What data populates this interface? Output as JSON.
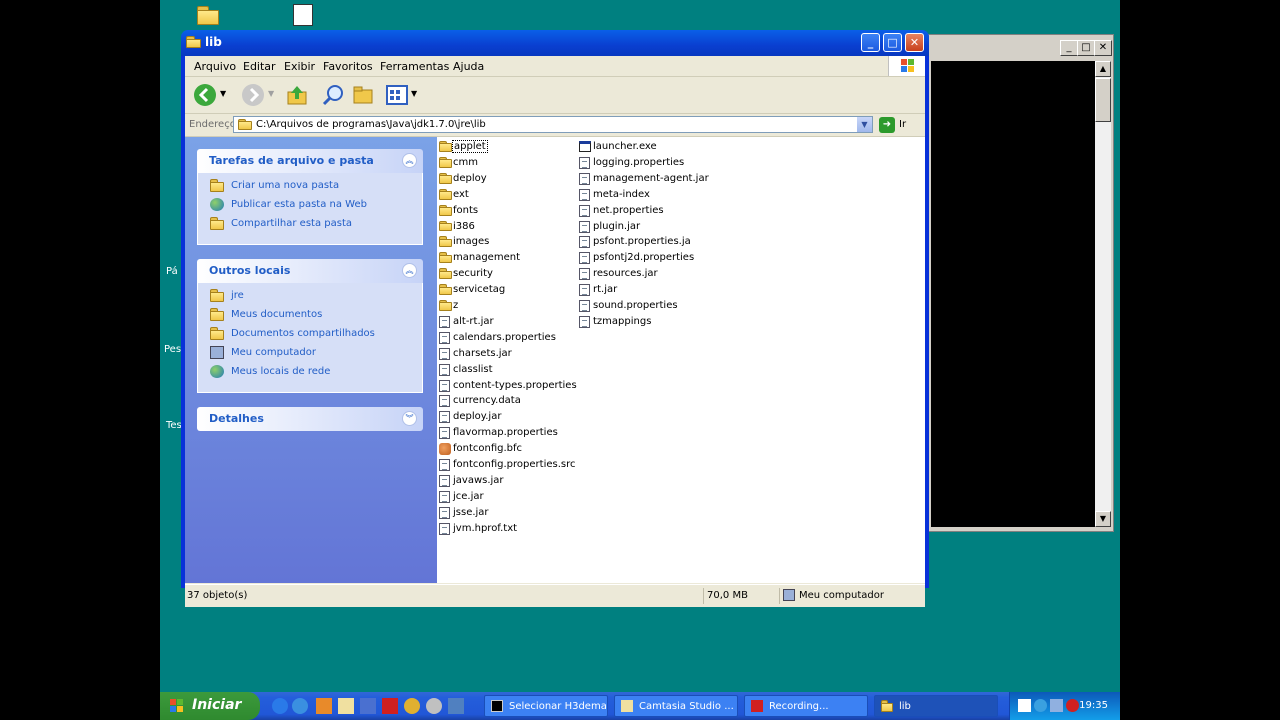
{
  "window": {
    "title": "lib",
    "menus": [
      "Arquivo",
      "Editar",
      "Exibir",
      "Favoritos",
      "Ferramentas",
      "Ajuda"
    ],
    "address_label": "Endereço",
    "address": "C:\\Arquivos de programas\\Java\\jdk1.7.0\\jre\\lib",
    "go_label": "Ir"
  },
  "tasks_panel": {
    "title": "Tarefas de arquivo e pasta",
    "items": [
      "Criar uma nova pasta",
      "Publicar esta pasta na Web",
      "Compartilhar esta pasta"
    ]
  },
  "places_panel": {
    "title": "Outros locais",
    "items": [
      "jre",
      "Meus documentos",
      "Documentos compartilhados",
      "Meu computador",
      "Meus locais de rede"
    ]
  },
  "details_panel": {
    "title": "Detalhes"
  },
  "files": {
    "col1": [
      {
        "name": "applet",
        "type": "folder"
      },
      {
        "name": "cmm",
        "type": "folder"
      },
      {
        "name": "deploy",
        "type": "folder"
      },
      {
        "name": "ext",
        "type": "folder"
      },
      {
        "name": "fonts",
        "type": "folder"
      },
      {
        "name": "i386",
        "type": "folder"
      },
      {
        "name": "images",
        "type": "folder"
      },
      {
        "name": "management",
        "type": "folder"
      },
      {
        "name": "security",
        "type": "folder"
      },
      {
        "name": "servicetag",
        "type": "folder"
      },
      {
        "name": "z",
        "type": "folder"
      },
      {
        "name": "alt-rt.jar",
        "type": "doc"
      },
      {
        "name": "calendars.properties",
        "type": "doc"
      },
      {
        "name": "charsets.jar",
        "type": "doc"
      },
      {
        "name": "classlist",
        "type": "doc"
      },
      {
        "name": "content-types.properties",
        "type": "doc"
      },
      {
        "name": "currency.data",
        "type": "doc"
      },
      {
        "name": "deploy.jar",
        "type": "doc"
      },
      {
        "name": "flavormap.properties",
        "type": "doc"
      },
      {
        "name": "fontconfig.bfc",
        "type": "java"
      },
      {
        "name": "fontconfig.properties.src",
        "type": "doc"
      },
      {
        "name": "javaws.jar",
        "type": "doc"
      },
      {
        "name": "jce.jar",
        "type": "doc"
      },
      {
        "name": "jsse.jar",
        "type": "doc"
      },
      {
        "name": "jvm.hprof.txt",
        "type": "doc"
      }
    ],
    "col2": [
      {
        "name": "launcher.exe",
        "type": "exe"
      },
      {
        "name": "logging.properties",
        "type": "doc"
      },
      {
        "name": "management-agent.jar",
        "type": "doc"
      },
      {
        "name": "meta-index",
        "type": "doc"
      },
      {
        "name": "net.properties",
        "type": "doc"
      },
      {
        "name": "plugin.jar",
        "type": "doc"
      },
      {
        "name": "psfont.properties.ja",
        "type": "doc"
      },
      {
        "name": "psfontj2d.properties",
        "type": "doc"
      },
      {
        "name": "resources.jar",
        "type": "doc"
      },
      {
        "name": "rt.jar",
        "type": "doc"
      },
      {
        "name": "sound.properties",
        "type": "doc"
      },
      {
        "name": "tzmappings",
        "type": "doc"
      }
    ]
  },
  "status": {
    "count": "37 objeto(s)",
    "size": "70,0 MB",
    "location": "Meu computador"
  },
  "desktop_labels": [
    "Pá",
    "Pes",
    "Tes"
  ],
  "taskbar": {
    "start": "Iniciar",
    "items": [
      "Selecionar H3dema",
      "Camtasia Studio ...",
      "Recording...",
      "lib"
    ],
    "clock": "19:35"
  },
  "colors": {
    "desktop": "#008080",
    "titlebar": "#0a5fe8",
    "sidepane": "#7ba2e7",
    "link": "#215dc6",
    "taskbar": "#245edb",
    "start": "#3c9a3c"
  }
}
